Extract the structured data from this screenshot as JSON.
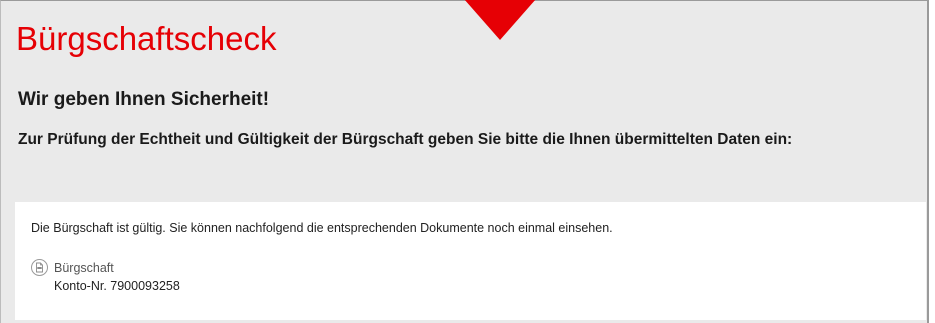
{
  "header": {
    "title": "Bürgschaftscheck",
    "brand_color": "#e60005"
  },
  "main": {
    "subtitle": "Wir geben Ihnen Sicherheit!",
    "prompt": "Zur Prüfung der Echtheit und Gültigkeit der Bürgschaft geben Sie bitte die Ihnen übermittelten Daten ein:"
  },
  "result": {
    "message": "Die Bürgschaft ist gültig. Sie können nachfolgend die entsprechenden Dokumente noch einmal einsehen.",
    "document": {
      "icon": "pdf-icon",
      "label": "Bürgschaft",
      "account": "Konto-Nr. 7900093258"
    }
  }
}
